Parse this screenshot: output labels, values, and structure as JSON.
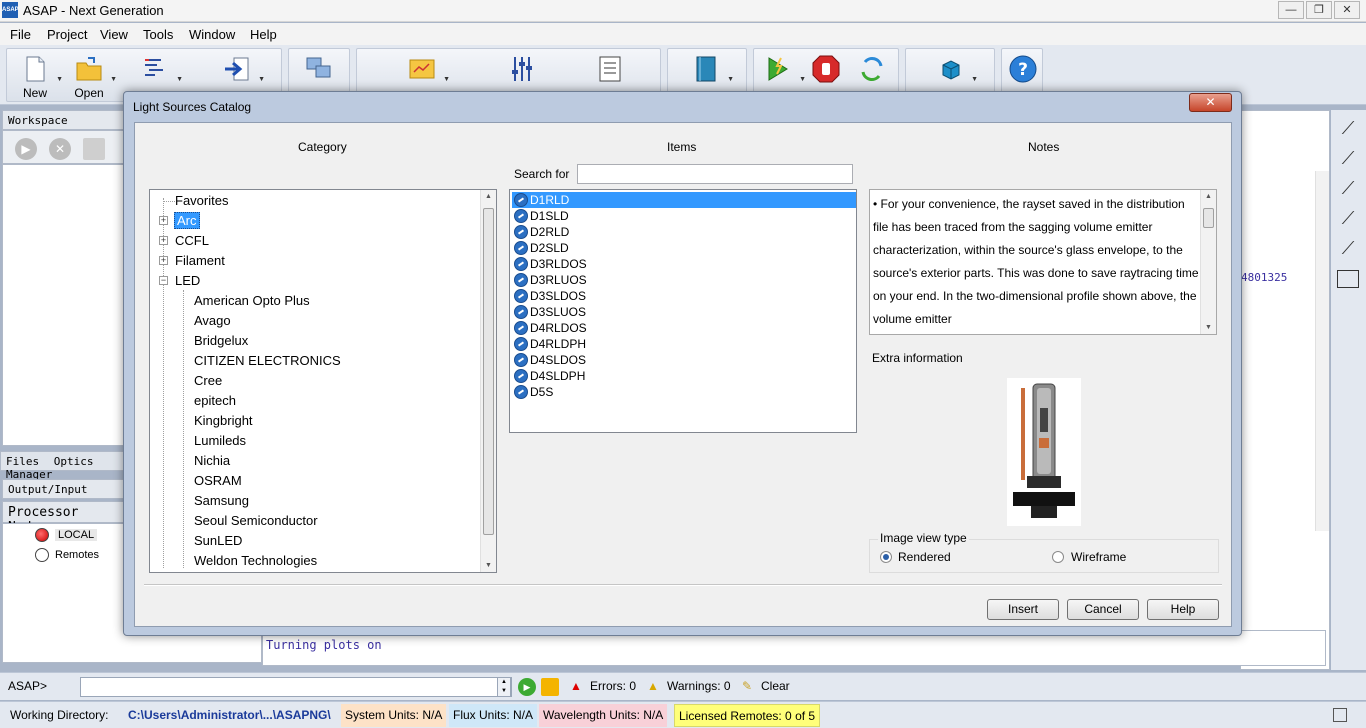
{
  "app": {
    "title": "ASAP - Next Generation",
    "logo_text": "ASAP"
  },
  "window_buttons": {
    "minimize": "—",
    "restore": "❐",
    "close": "✕"
  },
  "menu": [
    "File",
    "Project",
    "View",
    "Tools",
    "Window",
    "Help"
  ],
  "toolbar": {
    "new_label": "New",
    "open_label": "Open"
  },
  "workspace": {
    "title": "Workspace",
    "tabs": {
      "files": "Files",
      "optics": "Optics Manager"
    }
  },
  "output_panel": {
    "title": "Output/Input",
    "processor_title": "Processor Nodes",
    "local": "LOCAL",
    "remotes": "Remotes",
    "line": "Turning plots on",
    "right_number": "4801325"
  },
  "command": {
    "prompt": "ASAP>",
    "errors": "Errors: 0",
    "warnings": "Warnings: 0",
    "clear": "Clear"
  },
  "status": {
    "working_dir_label": "Working Directory:",
    "working_dir": "C:\\Users\\Administrator\\...\\ASAPNG\\",
    "system_units": "System Units: N/A",
    "flux_units": "Flux Units: N/A",
    "wavelength_units": "Wavelength Units: N/A",
    "licensed_remotes": "Licensed Remotes: 0 of 5"
  },
  "colors": {
    "selection": "#3399ff",
    "dialog_frame": "#bccadf",
    "close_red": "#c6452a"
  },
  "dialog": {
    "title": "Light Sources Catalog",
    "close_glyph": "✕",
    "category_header": "Category",
    "items_header": "Items",
    "notes_header": "Notes",
    "search_label": "Search for",
    "search_value": "",
    "categories": {
      "favorites": "Favorites",
      "arc": "Arc",
      "ccfl": "CCFL",
      "filament": "Filament",
      "led": "LED",
      "led_children": [
        "American Opto Plus",
        "Avago",
        "Bridgelux",
        "CITIZEN ELECTRONICS",
        "Cree",
        "epitech",
        "Kingbright",
        "Lumileds",
        "Nichia",
        "OSRAM",
        "Samsung",
        "Seoul Semiconductor",
        "SunLED",
        "Weldon Technologies"
      ]
    },
    "items": [
      "D1RLD",
      "D1SLD",
      "D2RLD",
      "D2SLD",
      "D3RLDOS",
      "D3RLUOS",
      "D3SLDOS",
      "D3SLUOS",
      "D4RLDOS",
      "D4RLDPH",
      "D4SLDOS",
      "D4SLDPH",
      "D5S"
    ],
    "notes": "• For your convenience, the rayset saved in the distribution file has been traced from the sagging volume emitter characterization, within the source's glass envelope, to the source's exterior parts.  This was done to save raytracing time on your end.  In the two-dimensional profile shown above, the volume emitter",
    "extra_info_label": "Extra information",
    "image_view_label": "Image view type",
    "view_rendered": "Rendered",
    "view_wireframe": "Wireframe",
    "buttons": {
      "insert": "Insert",
      "cancel": "Cancel",
      "help": "Help"
    }
  }
}
